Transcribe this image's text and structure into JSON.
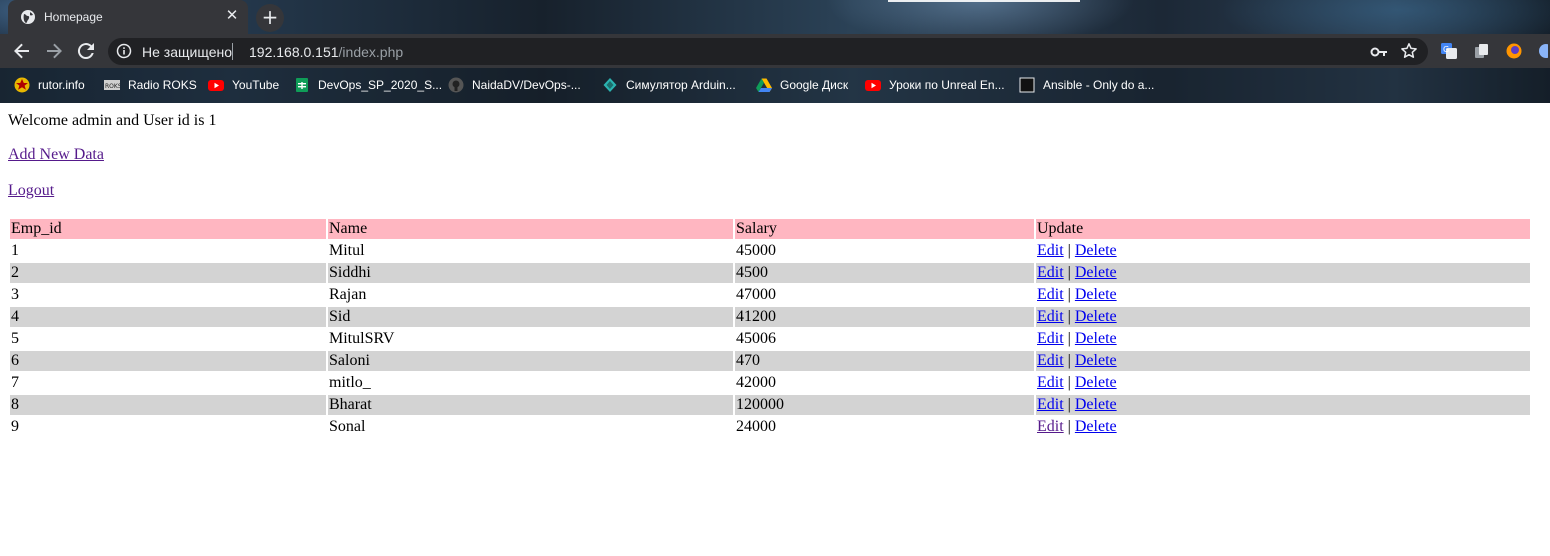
{
  "browser": {
    "tab": {
      "title": "Homepage"
    },
    "address": {
      "security_label": "Не защищено",
      "host": "192.168.0.151",
      "path": "/index.php"
    },
    "bookmarks": [
      {
        "label": "rutor.info",
        "icon": "rutor-icon"
      },
      {
        "label": "Radio ROKS",
        "icon": "radio-roks-icon"
      },
      {
        "label": "YouTube",
        "icon": "youtube-icon"
      },
      {
        "label": "DevOps_SP_2020_S...",
        "icon": "google-sheets-icon"
      },
      {
        "label": "NaidaDV/DevOps-...",
        "icon": "github-icon"
      },
      {
        "label": "Симулятор Arduin...",
        "icon": "tinkercad-icon"
      },
      {
        "label": "Google Диск",
        "icon": "google-drive-icon"
      },
      {
        "label": "Уроки по Unreal En...",
        "icon": "youtube-icon"
      },
      {
        "label": "Ansible - Only do a...",
        "icon": "blank-page-icon"
      }
    ]
  },
  "page": {
    "welcome": "Welcome admin and User id is 1",
    "add_link": "Add New Data",
    "logout_link": "Logout",
    "table": {
      "headers": [
        "Emp_id",
        "Name",
        "Salary",
        "Update"
      ],
      "edit_label": "Edit",
      "separator": "|",
      "delete_label": "Delete",
      "rows": [
        {
          "id": "1",
          "name": "Mitul",
          "salary": "45000"
        },
        {
          "id": "2",
          "name": "Siddhi",
          "salary": "4500"
        },
        {
          "id": "3",
          "name": "Rajan",
          "salary": "47000"
        },
        {
          "id": "4",
          "name": "Sid",
          "salary": "41200"
        },
        {
          "id": "5",
          "name": "MitulSRV",
          "salary": "45006"
        },
        {
          "id": "6",
          "name": "Saloni",
          "salary": "470"
        },
        {
          "id": "7",
          "name": "mitlo_",
          "salary": "42000"
        },
        {
          "id": "8",
          "name": "Bharat",
          "salary": "120000"
        },
        {
          "id": "9",
          "name": "Sonal",
          "salary": "24000"
        }
      ]
    }
  },
  "colors": {
    "header_row": "#ffb6c1",
    "stripe_row": "#d3d3d3",
    "link": "#0000ee",
    "visited_link": "#551a8b"
  }
}
